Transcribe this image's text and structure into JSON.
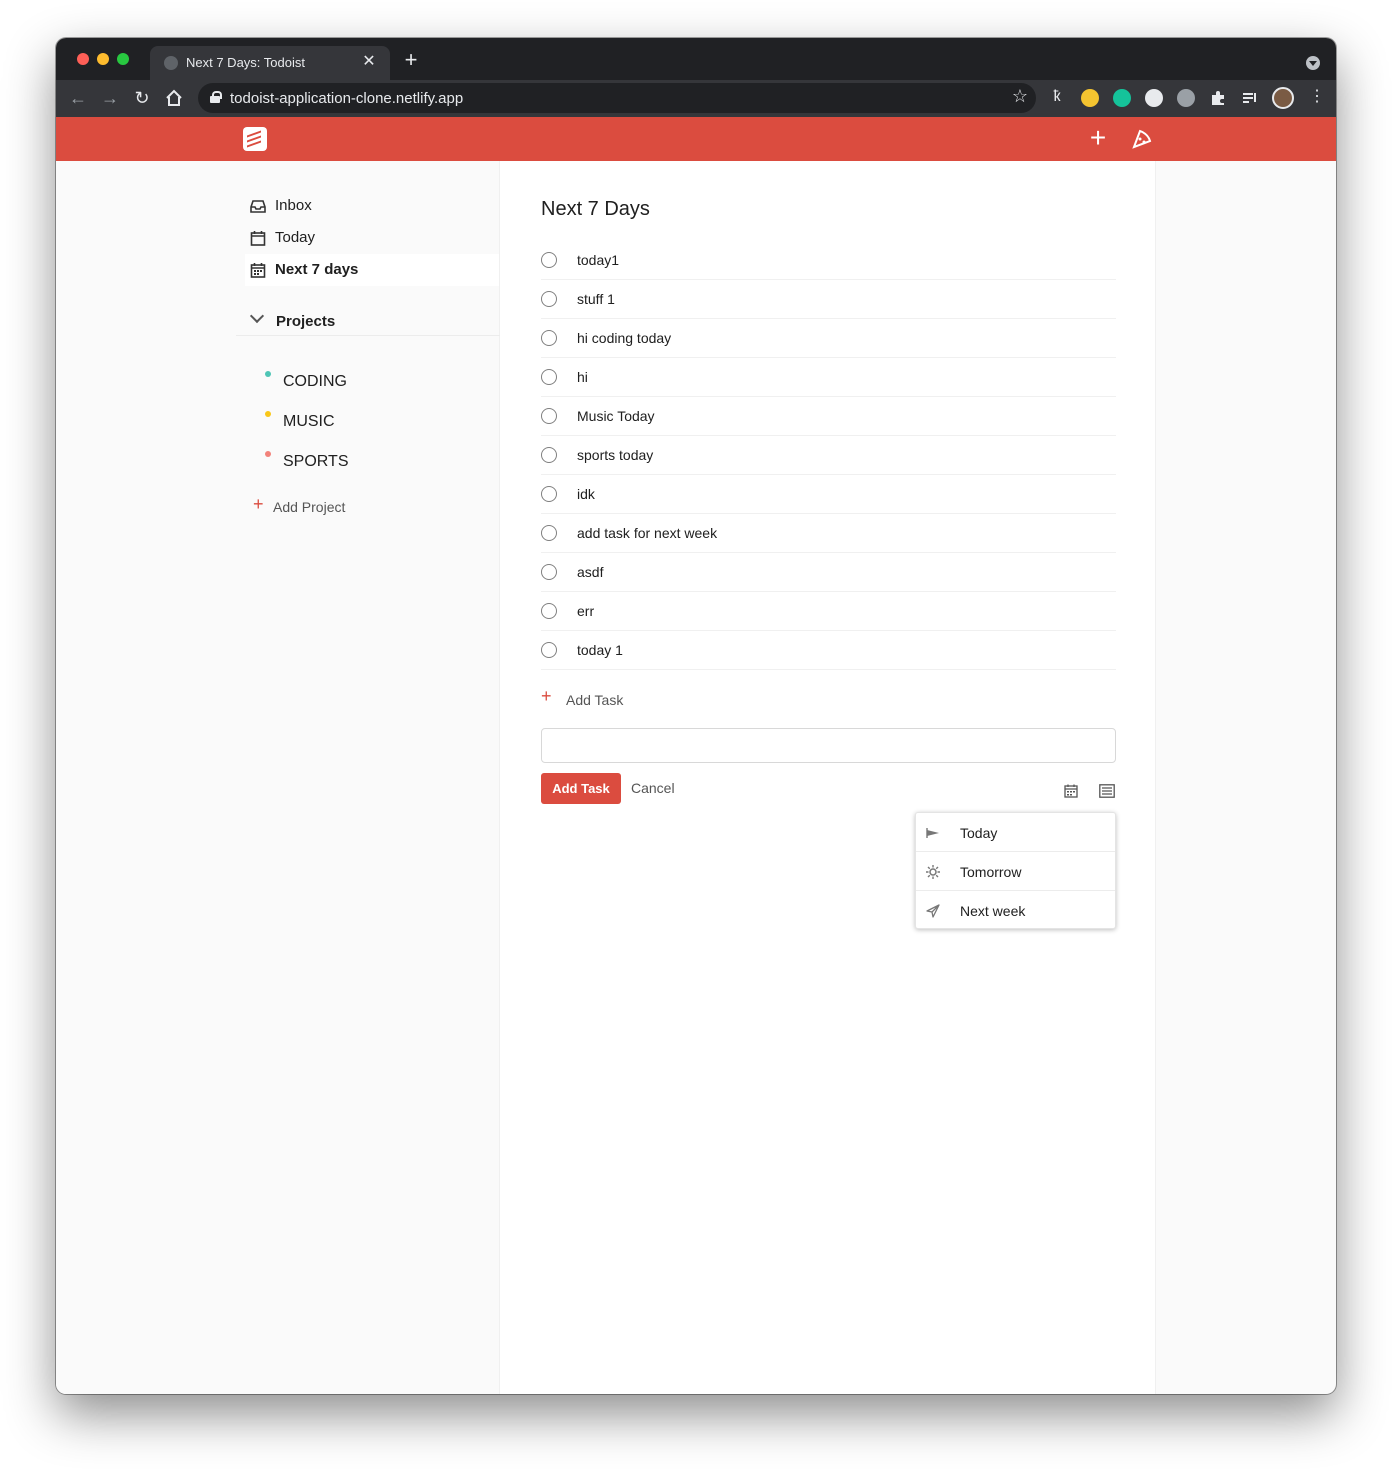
{
  "browser": {
    "tab_title": "Next 7 Days: Todoist",
    "tab_close": "✕",
    "new_tab": "+",
    "url": "todoist-application-clone.netlify.app"
  },
  "header": {
    "add_symbol": "+",
    "brand_color": "#db4c3f"
  },
  "sidebar": {
    "nav": [
      {
        "label": "Inbox",
        "icon": "inbox-icon"
      },
      {
        "label": "Today",
        "icon": "calendar-icon"
      },
      {
        "label": "Next 7 days",
        "icon": "calendar-grid-icon",
        "active": true
      }
    ],
    "projects_label": "Projects",
    "projects": [
      {
        "name": "CODING",
        "color": "#4ec5b5"
      },
      {
        "name": "MUSIC",
        "color": "#f9c718"
      },
      {
        "name": "SPORTS",
        "color": "#f2827a"
      }
    ],
    "add_project_symbol": "+",
    "add_project_label": "Add Project"
  },
  "main": {
    "title": "Next 7 Days",
    "tasks": [
      "today1",
      "stuff 1",
      "hi coding today",
      "hi",
      "Music Today",
      "sports today",
      "idk",
      "add task for next week",
      "asdf",
      "err",
      "today 1"
    ],
    "add_task_symbol": "+",
    "add_task_label": "Add Task",
    "input_value": "",
    "add_button": "Add Task",
    "cancel_button": "Cancel",
    "date_options": [
      {
        "label": "Today",
        "icon": "today-flag-icon"
      },
      {
        "label": "Tomorrow",
        "icon": "sun-icon"
      },
      {
        "label": "Next week",
        "icon": "paper-plane-icon"
      }
    ]
  }
}
